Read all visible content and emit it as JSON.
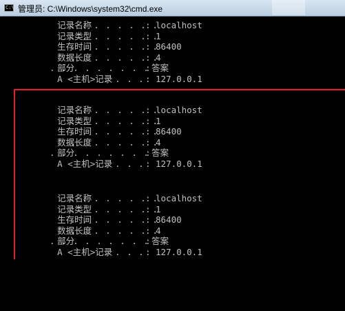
{
  "window": {
    "title": "管理员: C:\\Windows\\system32\\cmd.exe",
    "icon": "cmd-icon"
  },
  "accent": {
    "highlight_border": "#e21f26",
    "text": "#c0c0c0",
    "background": "#000000"
  },
  "records": [
    {
      "name_label": "记录名称",
      "name_dots": ". . . . . . . .",
      "name_value": "localhost",
      "type_label": "记录类型",
      "type_dots": ". . . . . . . .",
      "type_value": "1",
      "ttl_label": "生存时间",
      "ttl_dots": ". . . . . . . .",
      "ttl_value": "86400",
      "len_label": "数据长度",
      "len_dots": ". . . . . . . .",
      "len_value": "4",
      "section_label": "部分",
      "section_dots": ". . . . . . . . .",
      "section_value": "答案",
      "a_label": "A <主机>记录",
      "a_dots": ". . . .",
      "a_value": "127.0.0.1"
    },
    {
      "name_label": "记录名称",
      "name_dots": ". . . . . . . .",
      "name_value": "localhost",
      "type_label": "记录类型",
      "type_dots": ". . . . . . . .",
      "type_value": "1",
      "ttl_label": "生存时间",
      "ttl_dots": ". . . . . . . .",
      "ttl_value": "86400",
      "len_label": "数据长度",
      "len_dots": ". . . . . . . .",
      "len_value": "4",
      "section_label": "部分",
      "section_dots": ". . . . . . . . .",
      "section_value": "答案",
      "a_label": "A <主机>记录",
      "a_dots": ". . . .",
      "a_value": "127.0.0.1"
    },
    {
      "name_label": "记录名称",
      "name_dots": ". . . . . . . .",
      "name_value": "localhost",
      "type_label": "记录类型",
      "type_dots": ". . . . . . . .",
      "type_value": "1",
      "ttl_label": "生存时间",
      "ttl_dots": ". . . . . . . .",
      "ttl_value": "86400",
      "len_label": "数据长度",
      "len_dots": ". . . . . . . .",
      "len_value": "4",
      "section_label": "部分",
      "section_dots": ". . . . . . . . .",
      "section_value": "答案",
      "a_label": "A <主机>记录",
      "a_dots": ". . . .",
      "a_value": "127.0.0.1"
    }
  ]
}
